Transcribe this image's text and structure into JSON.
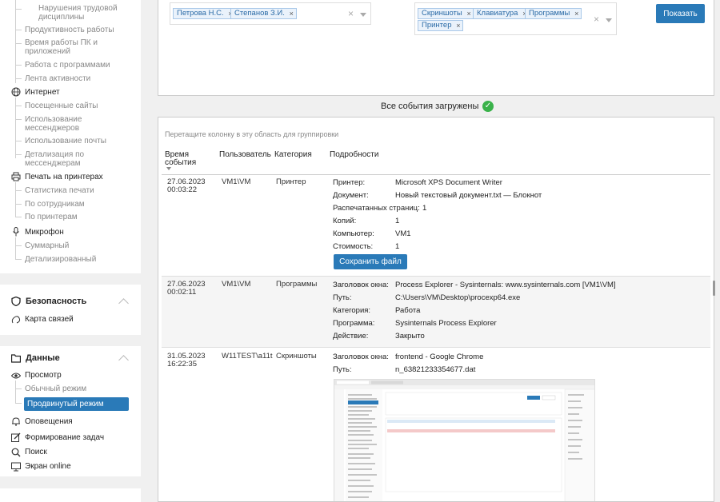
{
  "sidebar": {
    "top_items": [
      {
        "label": "Нарушения трудовой дисциплины"
      },
      {
        "label": "Продуктивность работы"
      },
      {
        "label": "Время работы ПК и приложений"
      },
      {
        "label": "Работа с программами"
      },
      {
        "label": "Лента активности"
      }
    ],
    "internet": {
      "label": "Интернет",
      "items": [
        "Посещенные сайты",
        "Использование мессенджеров",
        "Использование почты",
        "Детализация по мессенджерам"
      ]
    },
    "printing": {
      "label": "Печать на принтерах",
      "items": [
        "Статистика печати",
        "По сотрудникам",
        "По принтерам"
      ]
    },
    "microphone": {
      "label": "Микрофон",
      "items": [
        "Суммарный",
        "Детализированный"
      ]
    },
    "security": {
      "title": "Безопасность",
      "items": [
        "Карта связей"
      ]
    },
    "data": {
      "title": "Данные",
      "view_label": "Просмотр",
      "view_items": [
        "Обычный режим",
        "Продвинутый режим"
      ],
      "items": [
        "Оповещения",
        "Формирование задач",
        "Поиск",
        "Экран online"
      ]
    }
  },
  "filters": {
    "employees": [
      "Петрова Н.С.",
      "Степанов З.И."
    ],
    "categories": [
      "Скриншоты",
      "Клавиатура",
      "Программы",
      "Принтер"
    ],
    "show_button": "Показать",
    "clear_symbol": "×",
    "remove_symbol": "×"
  },
  "status": {
    "loaded_text": "Все события загружены"
  },
  "grid": {
    "group_hint": "Перетащите колонку в эту область для группировки",
    "columns": {
      "time": "Время события",
      "user": "Пользователь",
      "category": "Категория",
      "details": "Подробности"
    },
    "rows": [
      {
        "date": "27.06.2023",
        "time": "00:03:22",
        "user": "VM1\\VM",
        "category": "Принтер",
        "details": [
          {
            "k": "Принтер:",
            "v": "Microsoft XPS Document Writer"
          },
          {
            "k": "Документ:",
            "v": "Новый текстовый документ.txt — Блокнот"
          },
          {
            "k": "Распечатанных страниц:",
            "v": "1"
          },
          {
            "k": "Копий:",
            "v": "1"
          },
          {
            "k": "Компьютер:",
            "v": "VM1"
          },
          {
            "k": "Стоимость:",
            "v": "1"
          }
        ],
        "button": "Сохранить файл"
      },
      {
        "date": "27.06.2023",
        "time": "00:02:11",
        "user": "VM1\\VM",
        "category": "Программы",
        "details": [
          {
            "k": "Заголовок окна:",
            "v": "Process Explorer - Sysinternals: www.sysinternals.com [VM1\\VM]"
          },
          {
            "k": "Путь:",
            "v": "C:\\Users\\VM\\Desktop\\procexp64.exe"
          },
          {
            "k": "Категория:",
            "v": "Работа"
          },
          {
            "k": "Программа:",
            "v": "Sysinternals Process Explorer"
          },
          {
            "k": "Действие:",
            "v": "Закрыто"
          }
        ]
      },
      {
        "date": "31.05.2023",
        "time": "16:22:35",
        "user": "W11TEST\\a11t",
        "category": "Скриншоты",
        "details": [
          {
            "k": "Заголовок окна:",
            "v": "frontend - Google Chrome"
          },
          {
            "k": "Путь:",
            "v": "n_63821233354677.dat"
          }
        ]
      }
    ]
  },
  "colors": {
    "accent": "#2a7ab8",
    "success": "#3ab24a",
    "tag_bg": "#eaf2fb"
  }
}
